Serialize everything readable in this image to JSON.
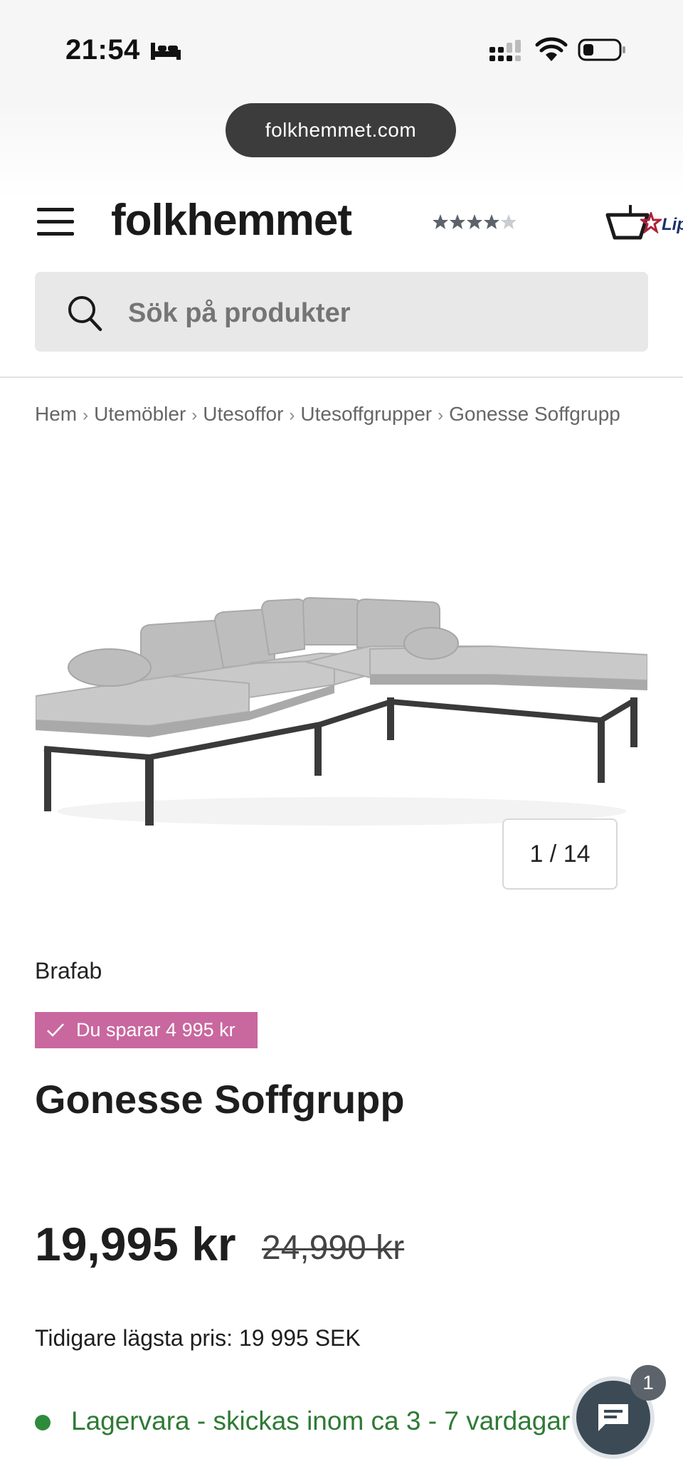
{
  "status_bar": {
    "time": "21:54"
  },
  "browser": {
    "url": "folkhemmet.com"
  },
  "header": {
    "logo": "folkhemmet",
    "rating": 4.5,
    "partner_label": "Lip"
  },
  "search": {
    "placeholder": "Sök på produkter"
  },
  "breadcrumb": {
    "items": [
      "Hem",
      "Utemöbler",
      "Utesoffor",
      "Utesoffgrupper",
      "Gonesse Soffgrupp"
    ],
    "separator": "›"
  },
  "gallery": {
    "counter": "1 / 14"
  },
  "product": {
    "brand": "Brafab",
    "savings_badge": "Du sparar 4 995 kr",
    "title": "Gonesse Soffgrupp",
    "price": "19,995 kr",
    "old_price": "24,990 kr",
    "lowest_price": "Tidigare lägsta pris: 19 995 SEK",
    "stock_status": "Lagervara - skickas inom ca 3 - 7 vardagar"
  },
  "chat": {
    "badge_count": "1"
  },
  "colors": {
    "badge_pink": "#c9679f",
    "stock_green": "#2e7a35",
    "chat_bg": "#3b4a55"
  }
}
